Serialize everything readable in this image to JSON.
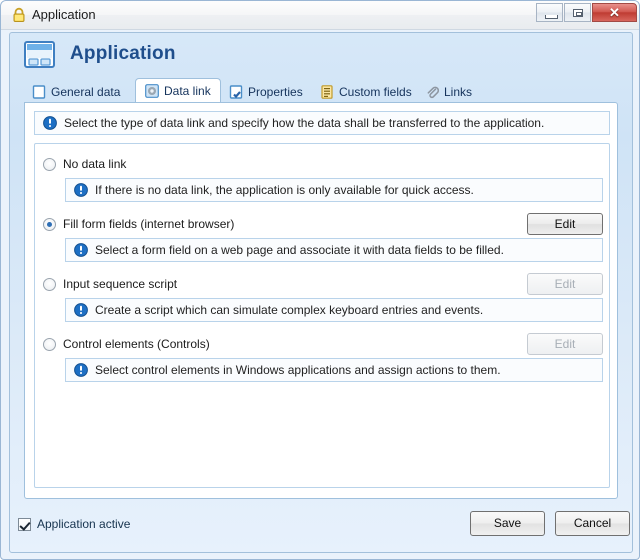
{
  "window": {
    "title": "Application",
    "lock_icon": "lock-icon",
    "controls": {
      "minimize": "minimize-icon",
      "maximize": "maximize-icon",
      "close": "✕"
    }
  },
  "header": {
    "title": "Application",
    "icon": "application-window-icon"
  },
  "tabs": [
    {
      "label": "General data",
      "icon": "blank-page-icon",
      "active": false
    },
    {
      "label": "Data link",
      "icon": "gear-box-icon",
      "active": true
    },
    {
      "label": "Properties",
      "icon": "checked-page-icon",
      "active": false
    },
    {
      "label": "Custom fields",
      "icon": "list-page-icon",
      "active": false
    },
    {
      "label": "Links",
      "icon": "paperclip-icon",
      "active": false
    }
  ],
  "main": {
    "top_info": "Select the type of data link and specify how the data shall be transferred to the application.",
    "options": [
      {
        "label": "No data link",
        "selected": false,
        "description": "If there is no data link, the application is only available for quick access.",
        "edit_label": "",
        "has_edit": false,
        "edit_enabled": false
      },
      {
        "label": "Fill form fields (internet browser)",
        "selected": true,
        "description": "Select a form field on a web page and associate it with data fields to be filled.",
        "edit_label": "Edit",
        "has_edit": true,
        "edit_enabled": true
      },
      {
        "label": "Input sequence script",
        "selected": false,
        "description": "Create a script which can simulate complex keyboard entries and events.",
        "edit_label": "Edit",
        "has_edit": true,
        "edit_enabled": false
      },
      {
        "label": "Control elements (Controls)",
        "selected": false,
        "description": "Select control elements in Windows applications and assign actions to them.",
        "edit_label": "Edit",
        "has_edit": true,
        "edit_enabled": false
      }
    ]
  },
  "footer": {
    "active_checkbox_label": "Application active",
    "active_checked": true,
    "save_label": "Save",
    "cancel_label": "Cancel"
  },
  "colors": {
    "accent": "#1f4e8c",
    "panel_border": "#9fc0dd",
    "info_border": "#b9d3ea",
    "radio_dot": "#2f6fb5",
    "close_red": "#bf3c33"
  }
}
